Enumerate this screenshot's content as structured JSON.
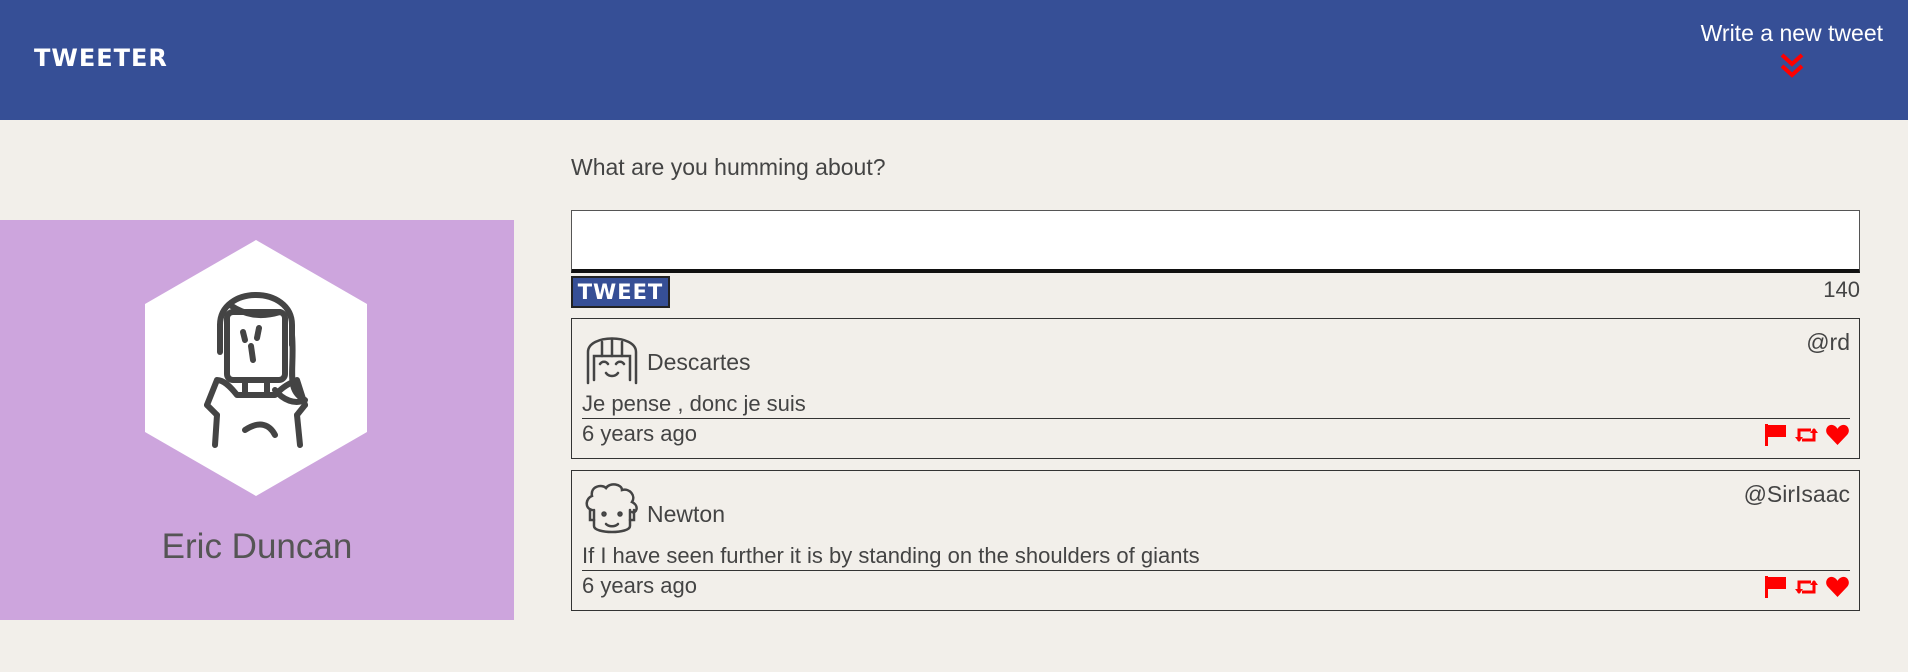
{
  "header": {
    "logo": "TWEETER",
    "write_link": "Write a new tweet"
  },
  "profile": {
    "name": "Eric Duncan"
  },
  "composer": {
    "prompt": "What are you humming about?",
    "input_value": "",
    "button_label": "TWEET",
    "counter": "140"
  },
  "tweets": [
    {
      "name": "Descartes",
      "handle": "@rd",
      "text": "Je pense , donc je suis",
      "time": "6 years ago"
    },
    {
      "name": "Newton",
      "handle": "@SirIsaac",
      "text": "If I have seen further it is by standing on the shoulders of giants",
      "time": "6 years ago"
    }
  ],
  "colors": {
    "navbar": "#364f96",
    "background": "#f2efea",
    "profile_bg": "#cda5dd",
    "accent_red": "#ff0000"
  },
  "icons": [
    "double-chevron-down-icon",
    "flag-icon",
    "retweet-icon",
    "heart-icon"
  ]
}
